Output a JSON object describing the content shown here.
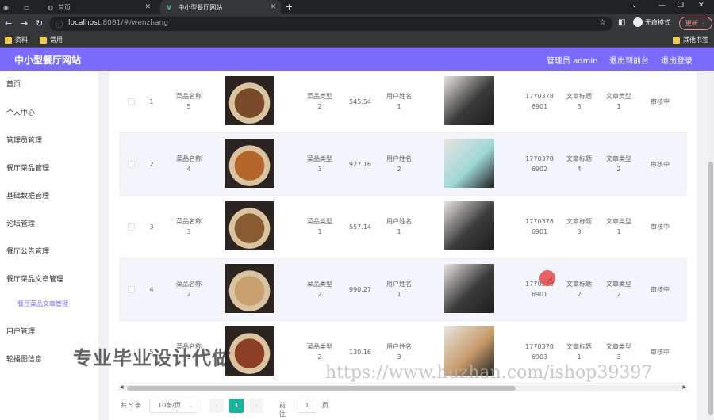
{
  "browser": {
    "tabs": [
      {
        "label": ""
      },
      {
        "label": ""
      },
      {
        "label": "首页"
      },
      {
        "label": "中小型餐厅网站"
      }
    ],
    "url_host": "localhost",
    "url_rest": ":8081/#/wenzhang",
    "incognito_label": "无痕模式",
    "update_label": "更新",
    "bookmarks": [
      "资料",
      "常用"
    ],
    "other_bookmarks": "其他书签"
  },
  "header": {
    "title": "中小型餐厅网站",
    "admin": "管理员 admin",
    "back_front": "退出到前台",
    "logout": "退出登录"
  },
  "sidebar": {
    "items": [
      {
        "label": "首页"
      },
      {
        "label": "个人中心"
      },
      {
        "label": "管理员管理"
      },
      {
        "label": "餐厅菜品管理"
      },
      {
        "label": "基础数据管理"
      },
      {
        "label": "论坛管理"
      },
      {
        "label": "餐厅公告管理"
      },
      {
        "label": "餐厅菜品文章管理"
      },
      {
        "label": "餐厅菜品文章管理"
      },
      {
        "label": "用户管理"
      },
      {
        "label": "轮播图信息"
      }
    ]
  },
  "table": {
    "rows": [
      {
        "index": "1",
        "dish_label": "菜品名称",
        "dish": "5",
        "type_label": "菜品类型",
        "type": "2",
        "price": "545.54",
        "user_label": "用户姓名",
        "user": "1",
        "phone_a": "1770378",
        "phone_b": "6901",
        "title_label": "文章标题",
        "title": "5",
        "atype_label": "文章类型",
        "atype": "1",
        "status": "审核中",
        "dish_img": "grilled-steak",
        "user_img": "man-portrait",
        "dish_color": "#7a4a2a",
        "user_color": "#3a3a3a"
      },
      {
        "index": "2",
        "dish_label": "菜品名称",
        "dish": "4",
        "type_label": "菜品类型",
        "type": "3",
        "price": "927.16",
        "user_label": "用户姓名",
        "user": "2",
        "phone_a": "1770378",
        "phone_b": "6902",
        "title_label": "文章标题",
        "title": "4",
        "atype_label": "文章类型",
        "atype": "2",
        "status": "审核中",
        "dish_img": "roast-meat",
        "user_img": "woman-portrait",
        "dish_color": "#b5672b",
        "user_color": "#9fd8d8"
      },
      {
        "index": "3",
        "dish_label": "菜品名称",
        "dish": "3",
        "type_label": "菜品类型",
        "type": "1",
        "price": "557.14",
        "user_label": "用户姓名",
        "user": "1",
        "phone_a": "1770378",
        "phone_b": "6901",
        "title_label": "文章标题",
        "title": "3",
        "atype_label": "文章类型",
        "atype": "1",
        "status": "审核中",
        "dish_img": "noodle-bowl",
        "user_img": "man-portrait",
        "dish_color": "#8a5a30",
        "user_color": "#3a3a3a"
      },
      {
        "index": "4",
        "dish_label": "菜品名称",
        "dish": "2",
        "type_label": "菜品类型",
        "type": "2",
        "price": "990.27",
        "user_label": "用户姓名",
        "user": "1",
        "phone_a": "1770378",
        "phone_b": "6901",
        "title_label": "文章标题",
        "title": "2",
        "atype_label": "文章类型",
        "atype": "2",
        "status": "审核中",
        "dish_img": "dish-collage",
        "user_img": "man-portrait",
        "dish_color": "#c9a070",
        "user_color": "#3a3a3a"
      },
      {
        "index": "5",
        "dish_label": "菜品名称",
        "dish": "1",
        "type_label": "菜品类型",
        "type": "2",
        "price": "130.16",
        "user_label": "用户姓名",
        "user": "3",
        "phone_a": "1770378",
        "phone_b": "6903",
        "title_label": "文章标题",
        "title": "1",
        "atype_label": "文章类型",
        "atype": "3",
        "status": "审核中",
        "dish_img": "meat-plate",
        "user_img": "cat-photo",
        "dish_color": "#8c3f25",
        "user_color": "#c79a6a"
      }
    ]
  },
  "pagination": {
    "total": "共 5 条",
    "page_size": "10条/页",
    "prev": "‹",
    "current": "1",
    "next": "›",
    "goto": "前往",
    "goto_value": "1",
    "page_unit": "页"
  },
  "watermark": {
    "cn": "专业毕业设计代做",
    "url": "https://www.huzhan.com/ishop39397"
  },
  "colors": {
    "accent": "#7a6bfa",
    "pager_active": "#14b69e"
  }
}
